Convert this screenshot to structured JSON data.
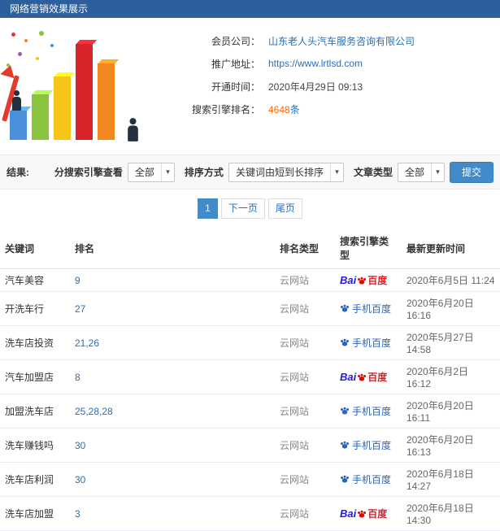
{
  "header": {
    "title": "网络营销效果展示"
  },
  "info": {
    "rows": [
      {
        "label": "会员公司：",
        "value": "山东老人头汽车服务咨询有限公司"
      },
      {
        "label": "推广地址：",
        "value": "https://www.lrtlsd.com"
      },
      {
        "label": "开通时间：",
        "value": "2020年4月29日 09:13"
      },
      {
        "label": "搜索引擎排名：",
        "value_num": "4648",
        "value_unit": "条"
      }
    ]
  },
  "filters": {
    "section_label": "结果:",
    "engine_label": "分搜索引擎查看",
    "engine_value": "全部",
    "sort_label": "排序方式",
    "sort_value": "关键词由短到长排序",
    "type_label": "文章类型",
    "type_value": "全部",
    "submit_label": "提交"
  },
  "icons": {
    "dropdown_arrow": "▼"
  },
  "pagination": {
    "current": "1",
    "next": "下一页",
    "last": "尾页"
  },
  "logos": {
    "baidu_bai": "Bai",
    "baidu_du": "百度",
    "mobile_baidu": "手机百度"
  },
  "table": {
    "headers": [
      "关键词",
      "排名",
      "排名类型",
      "搜索引擎类型",
      "最新更新时间"
    ],
    "rows": [
      {
        "keyword": "汽车美容",
        "rank": "9",
        "rank_type": "云网站",
        "engine": "百度",
        "time": "2020年6月5日 11:24"
      },
      {
        "keyword": "开洗车行",
        "rank": "27",
        "rank_type": "云网站",
        "engine": "手机百度",
        "time": "2020年6月20日 16:16"
      },
      {
        "keyword": "洗车店投资",
        "rank": "21,26",
        "rank_type": "云网站",
        "engine": "手机百度",
        "time": "2020年5月27日 14:58"
      },
      {
        "keyword": "汽车加盟店",
        "rank": "8",
        "rank_type": "云网站",
        "engine": "百度",
        "time": "2020年6月2日 16:12"
      },
      {
        "keyword": "加盟洗车店",
        "rank": "25,28,28",
        "rank_type": "云网站",
        "engine": "手机百度",
        "time": "2020年6月20日 16:11"
      },
      {
        "keyword": "洗车赚钱吗",
        "rank": "30",
        "rank_type": "云网站",
        "engine": "手机百度",
        "time": "2020年6月20日 16:13"
      },
      {
        "keyword": "洗车店利润",
        "rank": "30",
        "rank_type": "云网站",
        "engine": "手机百度",
        "time": "2020年6月18日 14:27"
      },
      {
        "keyword": "洗车店加盟",
        "rank": "3",
        "rank_type": "云网站",
        "engine": "百度",
        "time": "2020年6月18日 14:30"
      }
    ]
  }
}
